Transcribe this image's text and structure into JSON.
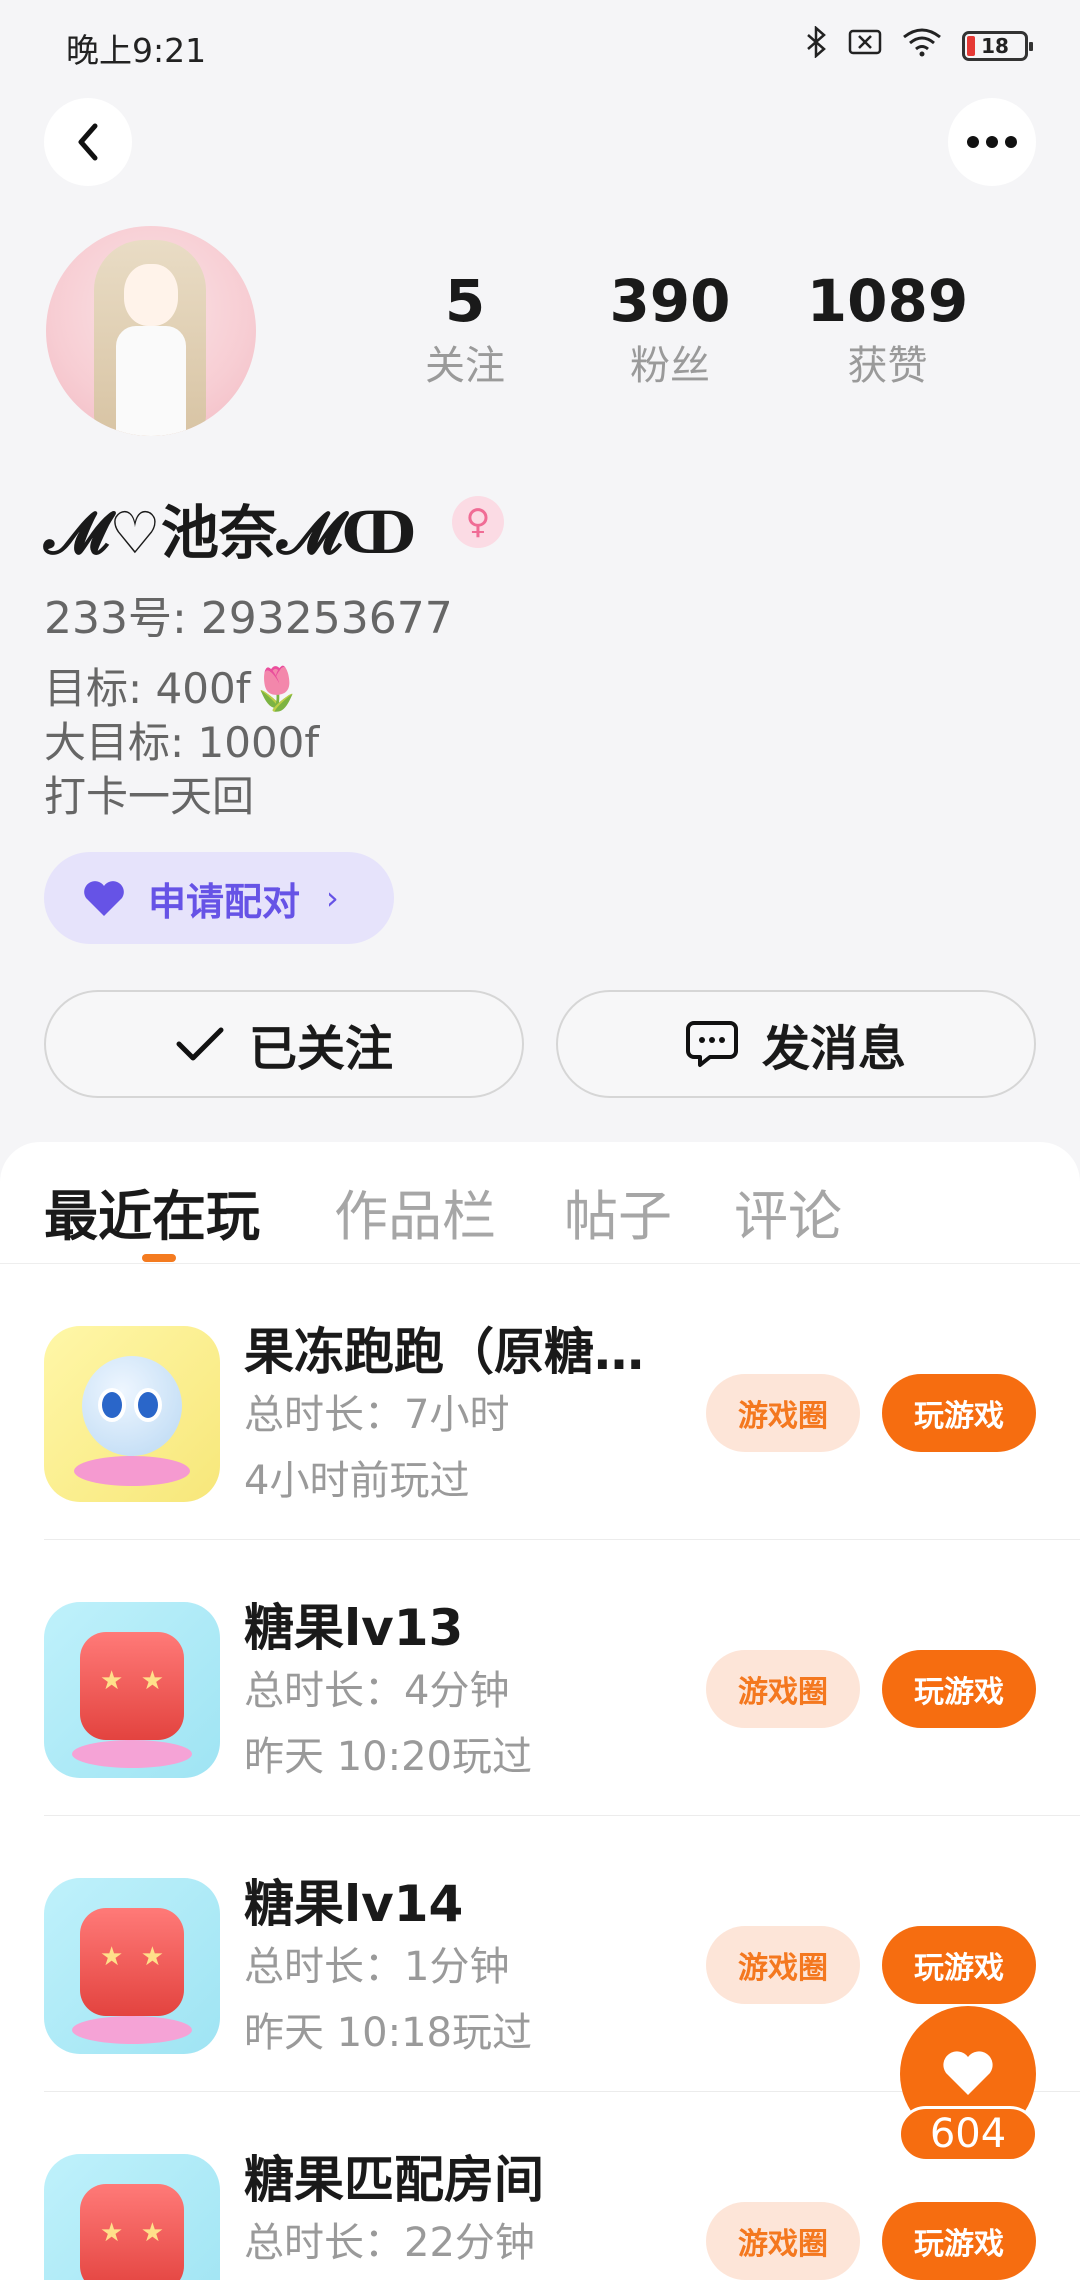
{
  "status_bar": {
    "time": "晚上9:21",
    "battery": "18"
  },
  "profile": {
    "name": "𝓜♡池奈𝓜ↀ",
    "gender_symbol": "♀",
    "uid": "233号: 293253677",
    "bio": [
      "目标: 400f🌷",
      "大目标: 1000f",
      "打卡一天回"
    ],
    "stats": [
      {
        "num": "5",
        "label": "关注"
      },
      {
        "num": "390",
        "label": "粉丝"
      },
      {
        "num": "1089",
        "label": "获赞"
      }
    ],
    "pair_label": "申请配对",
    "follow_label": "已关注",
    "message_label": "发消息"
  },
  "tabs": [
    "最近在玩",
    "作品栏",
    "帖子",
    "评论"
  ],
  "games": [
    {
      "title": "果冻跑跑（原糖…",
      "duration": "总时长：7小时",
      "last_played": "4小时前玩过",
      "icon": "jelly-character-icon"
    },
    {
      "title": "糖果lv13",
      "duration": "总时长：4分钟",
      "last_played": "昨天 10:20玩过",
      "icon": "candy-cube-icon"
    },
    {
      "title": "糖果lv14",
      "duration": "总时长：1分钟",
      "last_played": "昨天 10:18玩过",
      "icon": "candy-cube-icon"
    },
    {
      "title": "糖果匹配房间",
      "duration": "总时长：22分钟",
      "last_played": "",
      "icon": "candy-cube-icon"
    }
  ],
  "game_buttons": {
    "circle": "游戏圈",
    "play": "玩游戏"
  },
  "fab": {
    "count": "604"
  },
  "colors": {
    "accent": "#f66d10",
    "pair": "#6653e6"
  }
}
